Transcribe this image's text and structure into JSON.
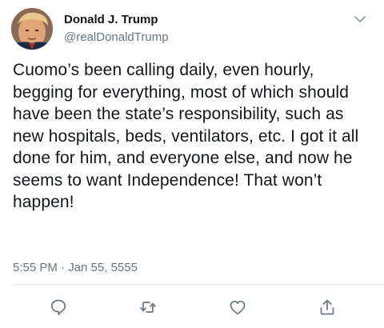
{
  "tweet": {
    "author_name": "Donald J. Trump",
    "author_handle": "@realDonaldTrump",
    "text": "Cuomo’s been calling daily, even hourly, begging for everything, most of which should have been the state’s responsibility, such as new hospitals, beds, ventilators, etc. I got it all done for him, and everyone else, and now he seems to want Independence! That won’t happen!",
    "timestamp": "5:55 PM · Jan 55, 5555"
  },
  "icons": {
    "menu": "chevron-down-icon",
    "reply": "reply-icon",
    "retweet": "retweet-icon",
    "like": "heart-icon",
    "share": "share-icon"
  },
  "colors": {
    "text": "#14171a",
    "secondary": "#657786",
    "icon": "#657786",
    "divider": "#e6ecf0"
  }
}
